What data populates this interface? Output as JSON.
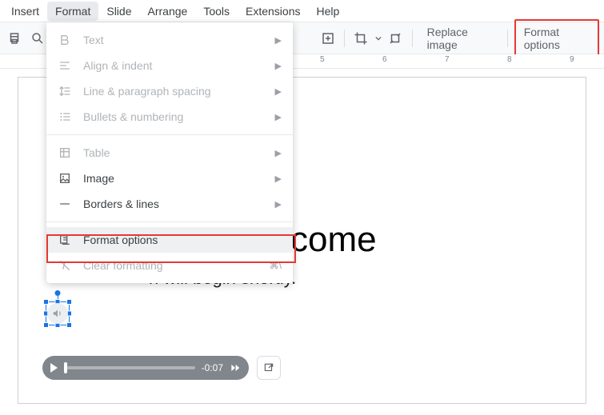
{
  "menubar": {
    "items": [
      "Insert",
      "Format",
      "Slide",
      "Arrange",
      "Tools",
      "Extensions",
      "Help"
    ],
    "active_index": 1
  },
  "toolbar": {
    "replace_image": "Replace image",
    "format_options": "Format options"
  },
  "ruler": {
    "labels": [
      "5",
      "6",
      "7",
      "8",
      "9"
    ]
  },
  "slide": {
    "title_fragment": "come",
    "subtitle_fragment": "n will begin shortly."
  },
  "audio": {
    "time": "-0:07"
  },
  "format_menu": {
    "groups": [
      [
        {
          "icon": "bold-icon",
          "label": "Text",
          "submenu": true,
          "disabled": true
        },
        {
          "icon": "align-icon",
          "label": "Align & indent",
          "submenu": true,
          "disabled": true
        },
        {
          "icon": "line-spacing-icon",
          "label": "Line & paragraph spacing",
          "submenu": true,
          "disabled": true
        },
        {
          "icon": "bullets-icon",
          "label": "Bullets & numbering",
          "submenu": true,
          "disabled": true
        }
      ],
      [
        {
          "icon": "table-icon",
          "label": "Table",
          "submenu": true,
          "disabled": true
        },
        {
          "icon": "image-icon",
          "label": "Image",
          "submenu": true,
          "disabled": false
        },
        {
          "icon": "borders-icon",
          "label": "Borders & lines",
          "submenu": true,
          "disabled": false
        }
      ],
      [
        {
          "icon": "format-options-icon",
          "label": "Format options",
          "submenu": false,
          "disabled": false,
          "highlighted": true
        },
        {
          "icon": "clear-format-icon",
          "label": "Clear formatting",
          "submenu": false,
          "disabled": true,
          "shortcut": "⌘\\"
        }
      ]
    ]
  }
}
